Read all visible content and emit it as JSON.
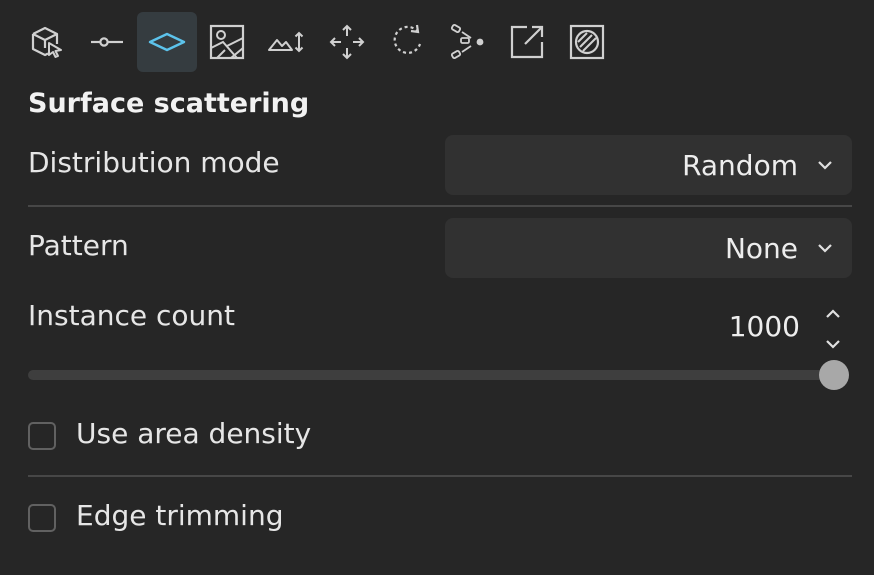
{
  "toolbar": {
    "tools": [
      {
        "icon": "cube-select-icon"
      },
      {
        "icon": "point-line-icon"
      },
      {
        "icon": "surface-icon",
        "active": true
      },
      {
        "icon": "texture-map-icon"
      },
      {
        "icon": "terrain-height-icon"
      },
      {
        "icon": "move-icon"
      },
      {
        "icon": "rotate-icon"
      },
      {
        "icon": "scatter-icon"
      },
      {
        "icon": "export-icon"
      },
      {
        "icon": "hatch-mask-icon"
      }
    ]
  },
  "section": {
    "title": "Surface scattering"
  },
  "distribution": {
    "label": "Distribution mode",
    "value": "Random"
  },
  "pattern": {
    "label": "Pattern",
    "value": "None"
  },
  "instance_count": {
    "label": "Instance count",
    "value": "1000",
    "slider_fraction": 1.0
  },
  "use_area_density": {
    "label": "Use area density",
    "checked": false
  },
  "edge_trimming": {
    "label": "Edge trimming",
    "checked": false
  },
  "colors": {
    "background": "#262626",
    "active_tool": "#353c40",
    "accent": "#5cc3ec",
    "control": "#313131"
  }
}
